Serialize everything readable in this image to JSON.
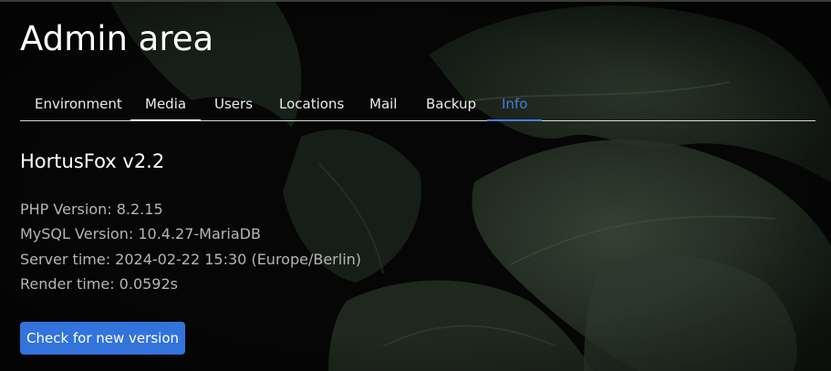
{
  "header": {
    "title": "Admin area"
  },
  "tabs": [
    {
      "label": "Environment",
      "active": false
    },
    {
      "label": "Media",
      "active": false
    },
    {
      "label": "Users",
      "active": false
    },
    {
      "label": "Locations",
      "active": false
    },
    {
      "label": "Mail",
      "active": false
    },
    {
      "label": "Backup",
      "active": false
    },
    {
      "label": "Info",
      "active": true
    }
  ],
  "info": {
    "app_version": "HortusFox v2.2",
    "php_version": "PHP Version: 8.2.15",
    "mysql_version": "MySQL Version: 10.4.27-MariaDB",
    "server_time": "Server time: 2024-02-22 15:30 (Europe/Berlin)",
    "render_time": "Render time: 0.0592s",
    "check_button_label": "Check for new version"
  },
  "colors": {
    "accent": "#3273dc",
    "active_tab": "#4a7ddb",
    "background": "#030403",
    "muted_text": "#b5b5b5",
    "foliage": "#2c382b"
  }
}
